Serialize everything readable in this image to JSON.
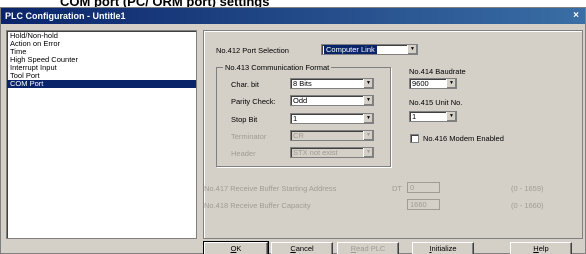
{
  "banner": {
    "text": "COM port (PC/ ORM port) settings"
  },
  "window": {
    "title": "PLC Configuration - Untitle1",
    "close_glyph": "×"
  },
  "sidebar": {
    "items": [
      {
        "label": "Hold/Non-hold",
        "selected": false
      },
      {
        "label": "Action on Error",
        "selected": false
      },
      {
        "label": "Time",
        "selected": false
      },
      {
        "label": "High Speed Counter",
        "selected": false
      },
      {
        "label": "Interrupt Input",
        "selected": false
      },
      {
        "label": "Tool Port",
        "selected": false
      },
      {
        "label": "COM Port",
        "selected": true
      }
    ]
  },
  "port_selection": {
    "label": "No.412 Port Selection",
    "value": "Computer Link"
  },
  "comm_format": {
    "title": "No.413 Communication Format",
    "char_bit": {
      "label": "Char. bit",
      "value": "8 Bits"
    },
    "parity": {
      "label": "Parity Check:",
      "value": "Odd"
    },
    "stop_bit": {
      "label": "Stop Bit",
      "value": "1"
    },
    "terminator": {
      "label": "Terminator",
      "value": "CR"
    },
    "header": {
      "label": "Header",
      "value": "STX not exist"
    }
  },
  "baudrate": {
    "label": "No.414 Baudrate",
    "value": "9600"
  },
  "unit_no": {
    "label": "No.415 Unit No.",
    "value": "1"
  },
  "modem": {
    "label": "No.416 Modem Enabled",
    "checked": false
  },
  "receive_buffer_start": {
    "label": "No.417 Receive Buffer Starting Address",
    "prefix": "DT",
    "value": "0",
    "range": "(0 - 1659)"
  },
  "receive_buffer_capacity": {
    "label": "No.418 Receive Buffer Capacity",
    "value": "1660",
    "range": "(0 - 1660)"
  },
  "buttons": {
    "ok": {
      "u": "O",
      "rest": "K"
    },
    "cancel": {
      "u": "C",
      "rest": "ancel"
    },
    "read_plc": {
      "u": "R",
      "rest": "ead PLC"
    },
    "initialize": {
      "u": "I",
      "rest": "nitialize"
    },
    "help": {
      "u": "H",
      "rest": "elp"
    }
  },
  "colors": {
    "title_bar": "#0a246a",
    "face": "#d4d0c8",
    "selection": "#0a246a"
  },
  "icons": {
    "dropdown": "chevron-down-icon",
    "close": "close-icon"
  }
}
